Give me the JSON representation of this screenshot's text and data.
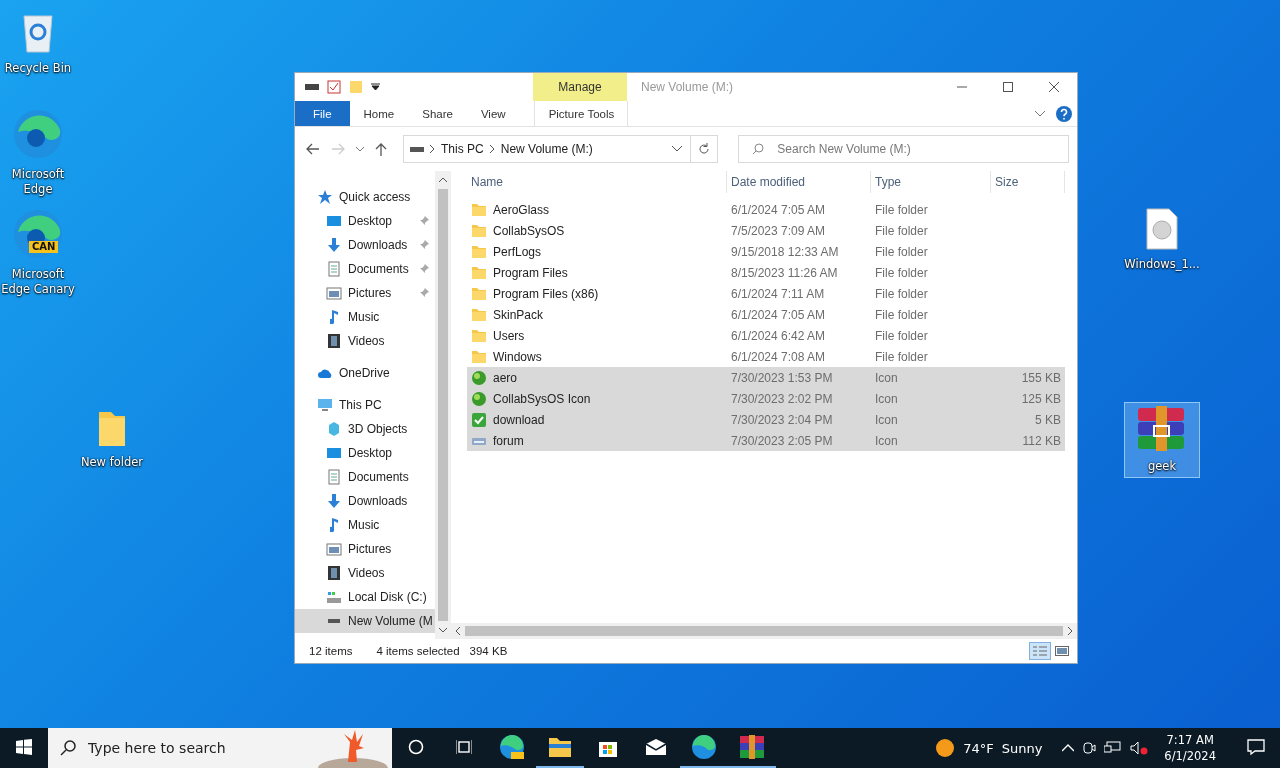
{
  "desktop_icons": [
    {
      "label": "Recycle Bin",
      "kind": "recycle",
      "selected": false
    },
    {
      "label": "Microsoft Edge",
      "kind": "edge",
      "selected": false
    },
    {
      "label": "Microsoft Edge Canary",
      "kind": "edge-canary",
      "badge": "CAN",
      "selected": false
    },
    {
      "label": "New folder",
      "kind": "folder",
      "selected": false
    },
    {
      "label": "Windows_1...",
      "kind": "file",
      "selected": false
    },
    {
      "label": "geek",
      "kind": "archive",
      "selected": true
    }
  ],
  "window": {
    "title": "New Volume (M:)",
    "context_tab": "Manage",
    "ribbon_tabs": [
      {
        "label": "File",
        "kind": "file",
        "selected": false
      },
      {
        "label": "Home",
        "kind": "tab",
        "selected": false
      },
      {
        "label": "Share",
        "kind": "tab",
        "selected": false
      },
      {
        "label": "View",
        "kind": "tab",
        "selected": false
      },
      {
        "label": "Picture Tools",
        "kind": "context",
        "selected": false
      }
    ],
    "address": [
      "This PC",
      "New Volume (M:)"
    ],
    "search": {
      "placeholder": "Search New Volume (M:)"
    },
    "sidebar": [
      {
        "label": "Quick access",
        "kind": "star",
        "selected": false,
        "children": [
          {
            "label": "Desktop",
            "kind": "desktop",
            "pinned": true,
            "selected": false
          },
          {
            "label": "Downloads",
            "kind": "downloads",
            "pinned": true,
            "selected": false
          },
          {
            "label": "Documents",
            "kind": "documents",
            "pinned": true,
            "selected": false
          },
          {
            "label": "Pictures",
            "kind": "pictures",
            "pinned": true,
            "selected": false
          },
          {
            "label": "Music",
            "kind": "music",
            "pinned": false,
            "selected": false
          },
          {
            "label": "Videos",
            "kind": "videos",
            "pinned": false,
            "selected": false
          }
        ]
      },
      {
        "label": "OneDrive",
        "kind": "cloud",
        "selected": false
      },
      {
        "label": "This PC",
        "kind": "pc",
        "selected": false,
        "children": [
          {
            "label": "3D Objects",
            "kind": "objects",
            "pinned": false,
            "selected": false
          },
          {
            "label": "Desktop",
            "kind": "desktop",
            "pinned": false,
            "selected": false
          },
          {
            "label": "Documents",
            "kind": "documents",
            "pinned": false,
            "selected": false
          },
          {
            "label": "Downloads",
            "kind": "downloads",
            "pinned": false,
            "selected": false
          },
          {
            "label": "Music",
            "kind": "music",
            "pinned": false,
            "selected": false
          },
          {
            "label": "Pictures",
            "kind": "pictures",
            "pinned": false,
            "selected": false
          },
          {
            "label": "Videos",
            "kind": "videos",
            "pinned": false,
            "selected": false
          },
          {
            "label": "Local Disk (C:)",
            "kind": "disk",
            "pinned": false,
            "selected": false
          },
          {
            "label": "New Volume (M",
            "kind": "drive",
            "pinned": false,
            "selected": true
          }
        ]
      }
    ],
    "columns": [
      "Name",
      "Date modified",
      "Type",
      "Size"
    ],
    "rows": [
      {
        "name": "AeroGlass",
        "date": "6/1/2024 7:05 AM",
        "type": "File folder",
        "kind": "folder",
        "selected": false
      },
      {
        "name": "CollabSysOS",
        "date": "7/5/2023 7:09 AM",
        "type": "File folder",
        "kind": "folder",
        "selected": false
      },
      {
        "name": "PerfLogs",
        "date": "9/15/2018 12:33 AM",
        "type": "File folder",
        "kind": "folder",
        "selected": false
      },
      {
        "name": "Program Files",
        "date": "8/15/2023 11:26 AM",
        "type": "File folder",
        "kind": "folder",
        "selected": false
      },
      {
        "name": "Program Files (x86)",
        "date": "6/1/2024 7:11 AM",
        "type": "File folder",
        "kind": "folder",
        "selected": false
      },
      {
        "name": "SkinPack",
        "date": "6/1/2024 7:05 AM",
        "type": "File folder",
        "kind": "folder",
        "selected": false
      },
      {
        "name": "Users",
        "date": "6/1/2024 6:42 AM",
        "type": "File folder",
        "kind": "folder",
        "selected": false
      },
      {
        "name": "Windows",
        "date": "6/1/2024 7:08 AM",
        "type": "File folder",
        "kind": "folder",
        "selected": false
      },
      {
        "name": "aero",
        "date": "7/30/2023 1:53 PM",
        "type": "Icon",
        "size": "155 KB",
        "kind": "globe",
        "selected": true
      },
      {
        "name": "CollabSysOS Icon",
        "date": "7/30/2023 2:02 PM",
        "type": "Icon",
        "size": "125 KB",
        "kind": "globe",
        "selected": true
      },
      {
        "name": "download",
        "date": "7/30/2023 2:04 PM",
        "type": "Icon",
        "size": "5 KB",
        "kind": "check",
        "selected": true
      },
      {
        "name": "forum",
        "date": "7/30/2023 2:05 PM",
        "type": "Icon",
        "size": "112 KB",
        "kind": "drive",
        "selected": true
      }
    ],
    "status_bar": {
      "count": "12 items",
      "selection": "4 items selected",
      "size": "394 KB"
    }
  },
  "taskbar": {
    "search": {
      "placeholder": "Type here to search"
    },
    "apps": [
      {
        "kind": "edge-canary",
        "active": false
      },
      {
        "kind": "explorer",
        "active": true
      },
      {
        "kind": "store",
        "active": false
      },
      {
        "kind": "mail",
        "active": false
      },
      {
        "kind": "edge",
        "active": true
      },
      {
        "kind": "archive",
        "active": true
      }
    ],
    "weather": {
      "temp": "74°F",
      "condition": "Sunny"
    },
    "time": "7:17 AM",
    "date": "6/1/2024"
  }
}
